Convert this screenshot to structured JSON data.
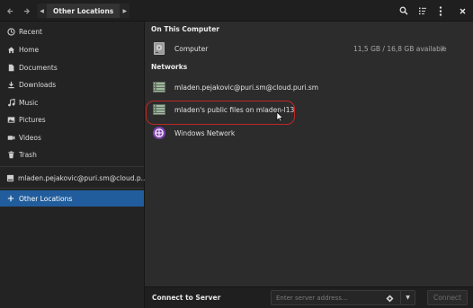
{
  "header": {
    "back_icon": "arrow-left-icon",
    "forward_icon": "arrow-right-icon",
    "breadcrumb": {
      "left_arrow": "chevron-left-icon",
      "current": "Other Locations",
      "right_arrow": "chevron-right-icon"
    },
    "search_icon": "search-icon",
    "view_options_icon": "view-options-icon",
    "menu_icon": "kebab-menu-icon",
    "close_icon": "close-icon"
  },
  "sidebar": {
    "items": [
      {
        "label": "Recent",
        "icon": "clock-icon"
      },
      {
        "label": "Home",
        "icon": "home-icon"
      },
      {
        "label": "Documents",
        "icon": "document-icon"
      },
      {
        "label": "Downloads",
        "icon": "download-icon"
      },
      {
        "label": "Music",
        "icon": "music-icon"
      },
      {
        "label": "Pictures",
        "icon": "pictures-icon"
      },
      {
        "label": "Videos",
        "icon": "video-icon"
      },
      {
        "label": "Trash",
        "icon": "trash-icon"
      },
      {
        "label": "mladen.pejakovic@puri.sm@cloud.p...",
        "icon": "network-drive-icon"
      },
      {
        "label": "Other Locations",
        "icon": "plus-icon",
        "active": true
      }
    ]
  },
  "main": {
    "on_this_computer": {
      "heading": "On This Computer",
      "computer": {
        "label": "Computer",
        "usage": "11,5 GB / 16,8 GB available",
        "mount_path": "/"
      }
    },
    "networks": {
      "heading": "Networks",
      "items": [
        {
          "label": "mladen.pejakovic@puri.sm@cloud.puri.sm",
          "icon": "network-server-icon"
        },
        {
          "label": "mladen's public files on mladen-l13",
          "icon": "network-server-icon",
          "highlighted": true
        },
        {
          "label": "Windows Network",
          "icon": "windows-network-icon"
        }
      ]
    }
  },
  "connect": {
    "label": "Connect to Server",
    "placeholder": "Enter server address...",
    "value": "",
    "button": "Connect"
  },
  "colors": {
    "accent": "#215d9c",
    "highlight_ring": "#c02626",
    "windows_network": "#7d3fb0"
  }
}
